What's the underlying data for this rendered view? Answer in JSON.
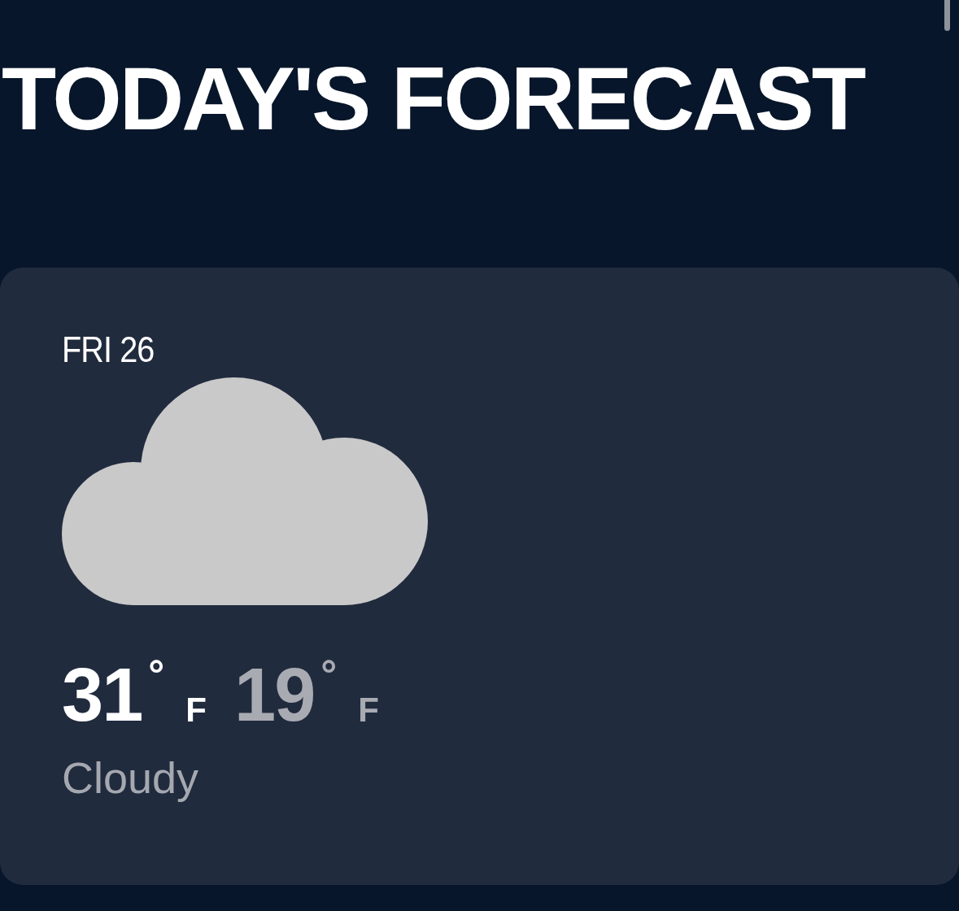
{
  "title": "TODAY'S FORECAST",
  "forecast": {
    "day": "FRI 26",
    "icon": {
      "kind": "cloudy"
    },
    "high": {
      "temp": "31",
      "degree": "°",
      "unit": "F"
    },
    "low": {
      "temp": "19",
      "degree": "°",
      "unit": "F"
    },
    "condition": "Cloudy"
  }
}
